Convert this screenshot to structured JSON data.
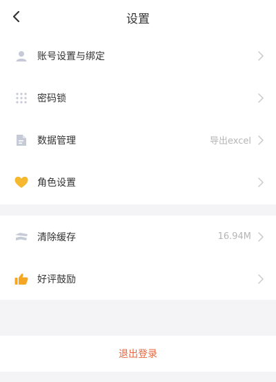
{
  "header": {
    "title": "设置"
  },
  "settings_group": {
    "items": [
      {
        "label": "账号设置与绑定",
        "value": "",
        "icon": "user-icon"
      },
      {
        "label": "密码锁",
        "value": "",
        "icon": "lock-grid-icon"
      },
      {
        "label": "数据管理",
        "value": "导出excel",
        "icon": "document-icon"
      },
      {
        "label": "角色设置",
        "value": "",
        "icon": "heart-icon"
      }
    ]
  },
  "misc_group": {
    "items": [
      {
        "label": "清除缓存",
        "value": "16.94M",
        "icon": "broom-icon"
      },
      {
        "label": "好评鼓励",
        "value": "",
        "icon": "thumbs-up-icon"
      }
    ]
  },
  "logout": {
    "label": "退出登录"
  },
  "colors": {
    "accent": "#e8663d",
    "heart": "#f5b82e",
    "thumb": "#f5a623",
    "icon_gray": "#c6c9d6"
  }
}
